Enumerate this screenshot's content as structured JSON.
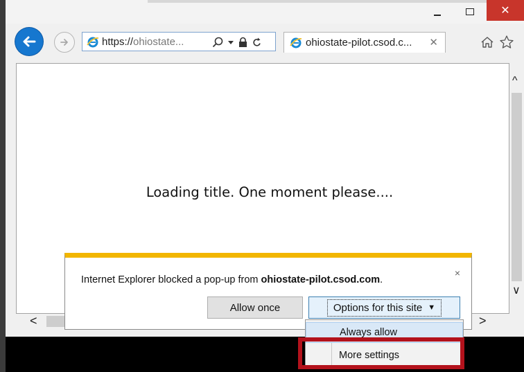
{
  "browser": {
    "address_proto": "https://",
    "address_host": "ohiostate...",
    "tab_title": "ohiostate-pilot.csod.c...",
    "minimize_icon": "minimize-icon",
    "maximize_icon": "maximize-icon",
    "close_glyph": "✕"
  },
  "page": {
    "loading_text": "Loading title. One moment please...."
  },
  "notification": {
    "message_prefix": "Internet Explorer blocked a pop-up from ",
    "message_site": "ohiostate-pilot.csod.com",
    "message_suffix": ".",
    "close_glyph": "×",
    "allow_once_label": "Allow once",
    "options_label": "Options for this site",
    "options_caret": "▼"
  },
  "dropdown": {
    "items": [
      {
        "label": "Always allow"
      },
      {
        "label": "More settings"
      }
    ]
  },
  "scrollbar": {
    "up": "^",
    "down": "∨",
    "left": "<",
    "right": ">"
  },
  "colors": {
    "back_button": "#1677cf",
    "close_button": "#c8352b",
    "notification_accent": "#f2b600",
    "highlight": "#b3121c"
  }
}
